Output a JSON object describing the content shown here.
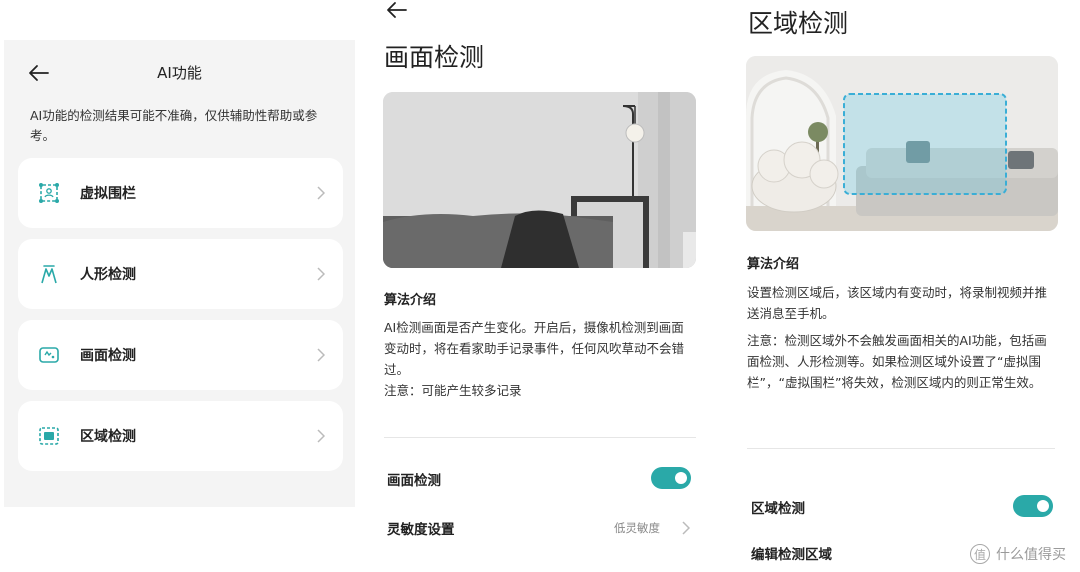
{
  "colors": {
    "accent": "#2aa9a8",
    "panel_bg": "#f4f4f4"
  },
  "ai_panel": {
    "title": "AI功能",
    "notice": "AI功能的检测结果可能不准确，仅供辅助性帮助或参考。",
    "items": [
      {
        "label": "虚拟围栏",
        "icon": "virtual-fence-icon"
      },
      {
        "label": "人形检测",
        "icon": "human-shape-icon"
      },
      {
        "label": "画面检测",
        "icon": "screen-detect-icon"
      },
      {
        "label": "区域检测",
        "icon": "area-detect-icon"
      }
    ]
  },
  "screen_panel": {
    "title": "画面检测",
    "algo_title": "算法介绍",
    "algo_desc": "AI检测画面是否产生变化。开启后，摄像机检测到画面变动时，将在看家助手记录事件，任何风吹草动不会错过。",
    "algo_note": "注意：可能产生较多记录",
    "toggle_label": "画面检测",
    "toggle_on": true,
    "sensitivity_label": "灵敏度设置",
    "sensitivity_value": "低灵敏度"
  },
  "area_panel": {
    "title": "区域检测",
    "algo_title": "算法介绍",
    "algo_desc": "设置检测区域后，该区域内有变动时，将录制视频并推送消息至手机。",
    "algo_note": "注意：检测区域外不会触发画面相关的AI功能，包括画面检测、人形检测等。如果检测区域外设置了“虚拟围栏”，“虚拟围栏”将失效，检测区域内的则正常生效。",
    "toggle_label": "区域检测",
    "toggle_on": true,
    "edit_label": "编辑检测区域"
  },
  "watermark": {
    "icon": "值",
    "text": "什么值得买"
  }
}
